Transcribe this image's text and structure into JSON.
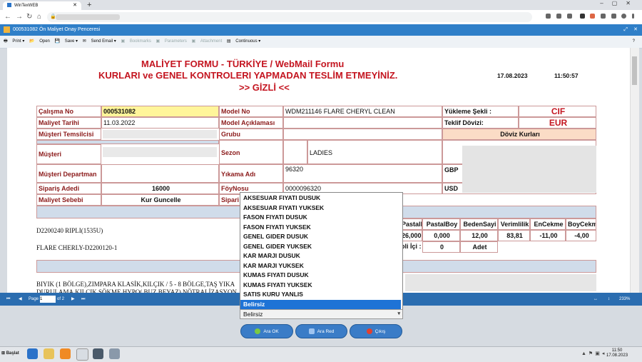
{
  "browser": {
    "tab_title": "WinTexWEB"
  },
  "app": {
    "window_title": "000531082 Ön Maliyet Onay Penceresi"
  },
  "toolbar": {
    "print": "Print",
    "open": "Open",
    "save": "Save",
    "send_email": "Send Email",
    "bookmarks": "Bookmarks",
    "parameters": "Parameters",
    "attachment": "Attachment",
    "continuous": "Continuous"
  },
  "doc": {
    "title1": "MALİYET FORMU - TÜRKİYE /  WebMail Formu",
    "title2": "KURLARI ve GENEL KONTROLERI YAPMADAN TESLİM ETMEYİNİZ.",
    "title3": ">> GİZLİ <<",
    "date": "17.08.2023",
    "time": "11:50:57",
    "lbl": {
      "calisma": "Çalışma No",
      "maliyet_tarihi": "Maliyet Tarihi",
      "temsilci": "Müşteri Temsilcisi",
      "musteri": "Müşteri",
      "departman": "Müşteri Departman",
      "siparis_adedi": "Sipariş Adedi",
      "maliyet_sebebi": "Maliyet Sebebi",
      "model_no": "Model No",
      "model_aciklama": "Model Açıklaması",
      "grubu": "Grubu",
      "sezon": "Sezon",
      "yikama": "Yıkama Adı",
      "foy": "FöyNosu",
      "sipari": "Sipari",
      "yukleme": "Yükleme Şekli :",
      "teklif": "Teklif Dövizi:",
      "doviz": "Döviz Kurları",
      "gbp": "GBP",
      "usd": "USD"
    },
    "val": {
      "calisma": "000531082",
      "maliyet_tarihi": "11.03.2022",
      "siparis_adedi": "16000",
      "maliyet_sebebi": "Kur Guncelle",
      "model_no": "WDM211146 FLARE CHERYL CLEAN",
      "sezon": "LADIES",
      "yikama": "96320",
      "foy": "0000096320",
      "yukleme": "CIF",
      "teklif": "EUR"
    },
    "grid": {
      "h1": "PastalEn",
      "h2": "PastalBoy",
      "h3": "BedenSayi",
      "h4": "Verimlilik",
      "h5": "EnCekme",
      "h6": "BoyCekme",
      "v1": "26,000",
      "v2": "0,000",
      "v3": "12,00",
      "v4": "83,81",
      "v5": "-11,00",
      "v6": "-4,00",
      "koli": "oli İçi :",
      "koli_val": "0",
      "adet": "Adet"
    },
    "text": {
      "d1": "D2200240 RIPLI(1535U)",
      "d2": "FLARE CHERLY-D2200120-1",
      "d3": "BIYIK (1 BÖLGE),ZIMPARA  KLASİK,KILÇIK / 5 - 8 BÖLGE,TAŞ YIKA",
      "d4": "DURULAMA,KILCIK SÖKME,HYPO( BUZ BEYAZ) NÖTRALİZASYON"
    }
  },
  "dropdown": {
    "options": [
      "AKSESUAR FIYATI DUSUK",
      "AKSESUAR FIYATI YUKSEK",
      "FASON FIYATI DUSUK",
      "FASON FIYATI YUKSEK",
      "GENEL GIDER DUSUK",
      "GENEL GIDER YUKSEK",
      "KAR MARJI DUSUK",
      "KAR MARJI YUKSEK",
      "KUMAS FIYATI DUSUK",
      "KUMAS FIYATI YUKSEK",
      "SATIS KURU YANLIS"
    ],
    "highlighted": "Belirsiz",
    "selected": "Belirsiz"
  },
  "pager": {
    "page_label": "Page",
    "page_value": "1",
    "of": "of 2",
    "zoom": "233%"
  },
  "buttons": {
    "approve": "Ara OK",
    "reject": "Ara Red",
    "exit": "Çıkış"
  },
  "taskbar": {
    "start": "Başlat",
    "time": "11:50",
    "date": "17.08.2023"
  },
  "colors": {
    "title_red": "#c41520",
    "appbar": "#2f7fc8",
    "button_blue": "#3a7cc7",
    "highlight": "#1e73d6"
  }
}
